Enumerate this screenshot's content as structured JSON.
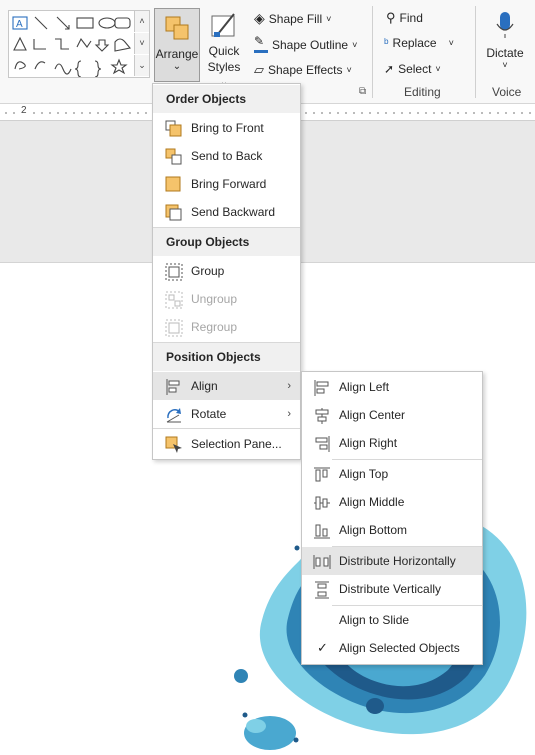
{
  "ribbon": {
    "arrange": {
      "label": "Arrange",
      "chevron": "⌄"
    },
    "quick_styles": {
      "line1": "Quick",
      "line2": "Styles",
      "chevron": "⌄"
    },
    "shape_fill": "Shape Fill",
    "shape_outline": "Shape Outline",
    "shape_effects": "Shape Effects",
    "find": "Find",
    "replace": "Replace",
    "select": "Select",
    "dictate": "Dictate",
    "group_editing": "Editing",
    "group_voice": "Voice"
  },
  "ruler": {
    "number": "2"
  },
  "arrange_menu": {
    "order_header": "Order Objects",
    "bring_to_front": "Bring to Front",
    "send_to_back": "Send to Back",
    "bring_forward": "Bring Forward",
    "send_backward": "Send Backward",
    "group_header": "Group Objects",
    "group": "Group",
    "ungroup": "Ungroup",
    "regroup": "Regroup",
    "position_header": "Position Objects",
    "align": "Align",
    "rotate": "Rotate",
    "selection_pane": "Selection Pane..."
  },
  "align_menu": {
    "align_left": "Align Left",
    "align_center": "Align Center",
    "align_right": "Align Right",
    "align_top": "Align Top",
    "align_middle": "Align Middle",
    "align_bottom": "Align Bottom",
    "distribute_horizontally": "Distribute Horizontally",
    "distribute_vertically": "Distribute Vertically",
    "align_to_slide": "Align to Slide",
    "align_selected_objects": "Align Selected Objects",
    "check_mark": "✓"
  },
  "colors": {
    "accent_orange": "#f5c36b",
    "accent_blue": "#2a6fbf",
    "blob_dark": "#1f5a8a",
    "blob_light": "#7fd0e6"
  }
}
